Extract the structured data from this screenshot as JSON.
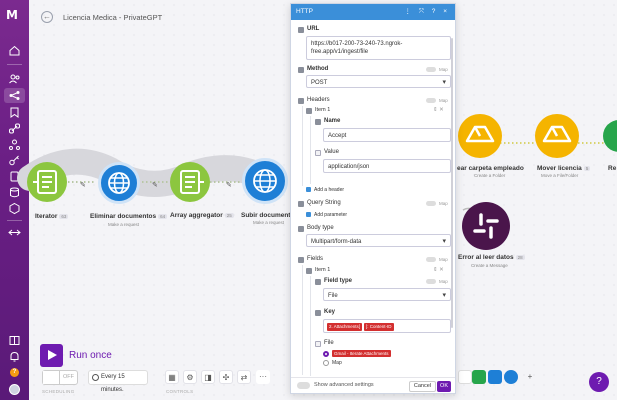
{
  "scenario": {
    "title": "Licencia Medica - PrivateGPT"
  },
  "nodes": [
    {
      "label": "Iterator",
      "badge": "63",
      "sub": ""
    },
    {
      "label": "Eliminar documentos",
      "badge": "64",
      "sub": "Make a request"
    },
    {
      "label": "Array aggregator",
      "badge": "25",
      "sub": ""
    },
    {
      "label": "Subir documento",
      "badge": "",
      "sub": "Make a request"
    },
    {
      "label": "ear carpeta empleado",
      "badge": "",
      "sub": "Create a Folder"
    },
    {
      "label": "Mover licencia",
      "badge": "5",
      "sub": "Move a File/Folder"
    },
    {
      "label": "Re",
      "badge": "",
      "sub": ""
    },
    {
      "label": "Error al leer datos",
      "badge": "28",
      "sub": "Create a Message"
    }
  ],
  "bottom": {
    "run_once": "Run once",
    "toggle_state": "OFF",
    "schedule": "Every 15 minutes.",
    "scheduling_caption": "SCHEDULING",
    "controls_caption": "CONTROLS",
    "more": "···",
    "add": "+",
    "chat": "?"
  },
  "modal": {
    "title": "HTTP",
    "header_icons": "⋮ ⤧ ? ×",
    "url_label": "URL",
    "url_value": "https://b017-200-73-240-73.ngrok-free.app/v1/ingest/file",
    "method_label": "Method",
    "method_value": "POST",
    "map": "Map",
    "headers_label": "Headers",
    "header_item": "Item 1",
    "name_label": "Name",
    "name_value": "Accept",
    "value_label": "Value",
    "value_value": "application/json",
    "add_header": "Add a header",
    "query_label": "Query String",
    "add_parameter": "Add parameter",
    "body_type_label": "Body type",
    "body_type_value": "Multipart/form-data",
    "fields_label": "Fields",
    "field_item": "Item 1",
    "field_type_label": "Field type",
    "field_type_value": "File",
    "key_label": "Key",
    "key_pill_1": "2. Attachments[",
    "key_pill_2": "]: Content-ID",
    "file_label": "File",
    "file_option_1": "Gmail - Iterate Attachments",
    "file_option_2": "Map",
    "advanced": "Show advanced settings",
    "cancel": "Cancel",
    "ok": "OK"
  },
  "colors": {
    "brand": "#6e1bb0",
    "http_blue": "#1e7fd6",
    "iterator_green": "#8cc63f",
    "drive_yellow": "#f5b400",
    "slack_purple": "#4a154b"
  }
}
